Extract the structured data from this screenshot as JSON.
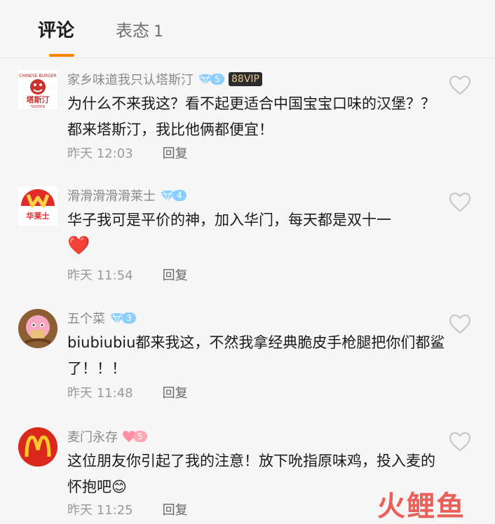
{
  "tabs": {
    "comments_label": "评论",
    "reactions_label": "表态",
    "reactions_count": "1"
  },
  "comments": [
    {
      "username": "家乡味道我只认塔斯汀",
      "level": "5",
      "vip": "88VIP",
      "content": "为什么不来我这？看不起更适合中国宝宝口味的汉堡？？都来塔斯汀，我比他俩都便宜！",
      "time": "昨天 12:03",
      "reply_label": "回复",
      "avatar_text": "塔斯汀"
    },
    {
      "username": "滑滑滑滑滑莱士",
      "level": "4",
      "content": "华子我可是平价的神，加入华门，每天都是双十一",
      "emoji": "❤️",
      "time": "昨天 11:54",
      "reply_label": "回复",
      "avatar_text": "华莱士"
    },
    {
      "username": "五个菜",
      "level": "3",
      "content": "biubiubiu都来我这，不然我拿经典脆皮手枪腿把你们都鲨了！！！",
      "time": "昨天 11:48",
      "reply_label": "回复"
    },
    {
      "username": "麦门永存",
      "level": "5",
      "content": "这位朋友你引起了我的注意！放下吮指原味鸡，投入麦的怀抱吧😊",
      "time": "昨天 11:25",
      "reply_label": "回复"
    }
  ],
  "colors": {
    "accent": "#ff8200",
    "background": "#f6f6f6",
    "badge_blue": "#8ccfff",
    "badge_pink": "#ffa6b4"
  },
  "watermark": "火鲤鱼"
}
